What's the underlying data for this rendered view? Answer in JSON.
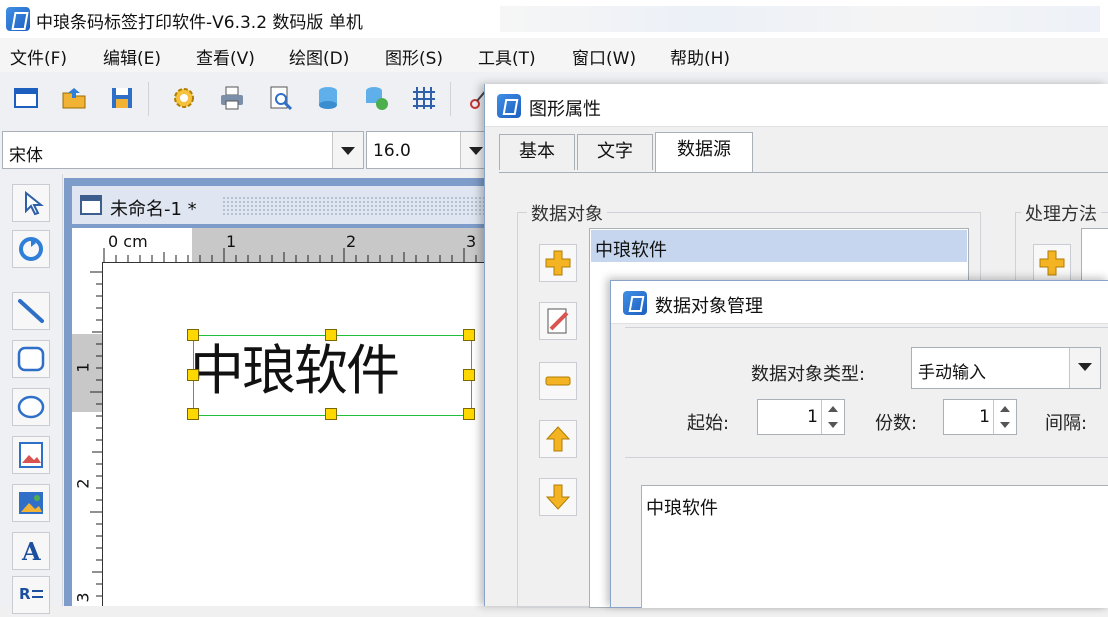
{
  "app": {
    "title": "中琅条码标签打印软件-V6.3.2 数码版 单机"
  },
  "menu": [
    "文件(F)",
    "编辑(E)",
    "查看(V)",
    "绘图(D)",
    "图形(S)",
    "工具(T)",
    "窗口(W)",
    "帮助(H)"
  ],
  "fontbar": {
    "font_name": "宋体",
    "font_size": "16.0"
  },
  "document": {
    "tab_title": "未命名-1 *",
    "ruler_unit": "0 cm",
    "label_text": "中琅软件",
    "ruler_h_marks": [
      "1",
      "2",
      "3"
    ],
    "ruler_v_marks": [
      "1",
      "2",
      "3"
    ]
  },
  "left_tools": [
    "pointer-tool",
    "pan-tool",
    "line-tool",
    "rounded-rect-tool",
    "ellipse-tool",
    "image-tool",
    "picture-tool",
    "text-tool",
    "richtext-tool"
  ],
  "prop_dialog": {
    "title": "图形属性",
    "tabs": [
      "基本",
      "文字",
      "数据源"
    ],
    "active_tab": "数据源",
    "group_data_object": "数据对象",
    "group_process": "处理方法",
    "data_list": [
      "中琅软件"
    ]
  },
  "mgr_dialog": {
    "title": "数据对象管理",
    "type_label": "数据对象类型:",
    "type_value": "手动输入",
    "start_label": "起始:",
    "start_value": "1",
    "copies_label": "份数:",
    "copies_value": "1",
    "interval_label": "间隔:",
    "content": "中琅软件"
  },
  "colors": {
    "selection_border": "#1fbf3a",
    "handle_fill": "#ffd800",
    "doc_frame": "#7e9cc9"
  }
}
